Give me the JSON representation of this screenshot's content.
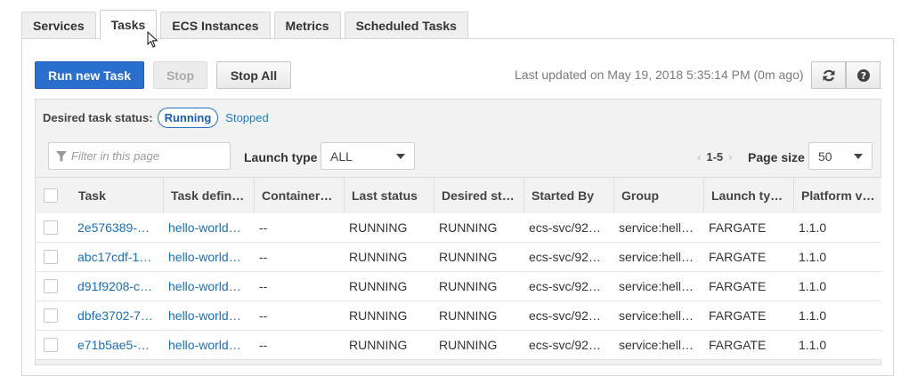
{
  "tabs": [
    "Services",
    "Tasks",
    "ECS Instances",
    "Metrics",
    "Scheduled Tasks"
  ],
  "active_tab": "Tasks",
  "toolbar": {
    "run_new_task": "Run new Task",
    "stop": "Stop",
    "stop_all": "Stop All",
    "last_updated": "Last updated on May 19, 2018 5:35:14 PM (0m ago)",
    "refresh_icon": "refresh-icon",
    "help_icon": "help-icon"
  },
  "filters": {
    "desired_status_label": "Desired task status:",
    "running": "Running",
    "stopped": "Stopped",
    "filter_placeholder": "Filter in this page",
    "launch_type_label": "Launch type",
    "launch_type_value": "ALL",
    "pagination": "1-5",
    "page_size_label": "Page size",
    "page_size_value": "50"
  },
  "table": {
    "columns": [
      "Task",
      "Task defin…",
      "Container…",
      "Last status",
      "Desired st…",
      "Started By",
      "Group",
      "Launch ty…",
      "Platform v…"
    ],
    "rows": [
      [
        "2e576389-…",
        "hello-world…",
        "--",
        "RUNNING",
        "RUNNING",
        "ecs-svc/92…",
        "service:hell…",
        "FARGATE",
        "1.1.0"
      ],
      [
        "abc17cdf-1…",
        "hello-world…",
        "--",
        "RUNNING",
        "RUNNING",
        "ecs-svc/92…",
        "service:hell…",
        "FARGATE",
        "1.1.0"
      ],
      [
        "d91f9208-c…",
        "hello-world…",
        "--",
        "RUNNING",
        "RUNNING",
        "ecs-svc/92…",
        "service:hell…",
        "FARGATE",
        "1.1.0"
      ],
      [
        "dbfe3702-7…",
        "hello-world…",
        "--",
        "RUNNING",
        "RUNNING",
        "ecs-svc/92…",
        "service:hell…",
        "FARGATE",
        "1.1.0"
      ],
      [
        "e71b5ae5-…",
        "hello-world…",
        "--",
        "RUNNING",
        "RUNNING",
        "ecs-svc/92…",
        "service:hell…",
        "FARGATE",
        "1.1.0"
      ]
    ]
  },
  "colors": {
    "primary": "#2a6fce",
    "link": "#1a6fb7"
  }
}
